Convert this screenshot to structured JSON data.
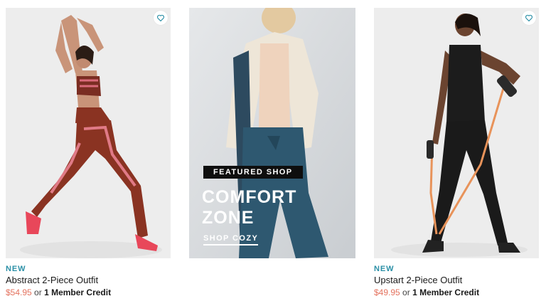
{
  "products": [
    {
      "badge": "NEW",
      "name": "Abstract 2-Piece Outfit",
      "price": "$54.95",
      "or": "or",
      "credit": "1 Member Credit",
      "favorite_icon": "heart-outline-icon"
    },
    {
      "badge": "NEW",
      "name": "Upstart 2-Piece Outfit",
      "price": "$49.95",
      "or": "or",
      "credit": "1 Member Credit",
      "favorite_icon": "heart-outline-icon"
    }
  ],
  "featured": {
    "chip": "FEATURED SHOP",
    "title": "COMFORT ZONE",
    "cta": "SHOP COZY"
  },
  "colors": {
    "badge": "#2a8fa6",
    "price": "#e4735f",
    "heart": "#2a8fa6"
  }
}
